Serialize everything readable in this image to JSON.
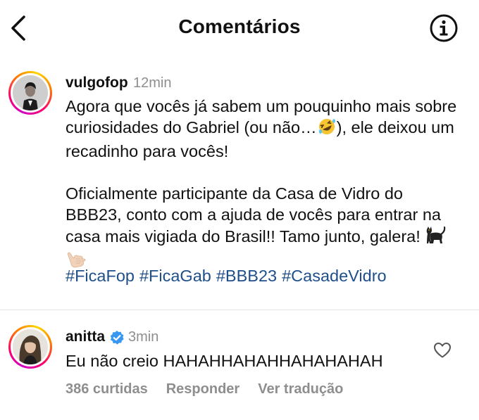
{
  "header": {
    "title": "Comentários",
    "back_icon": "chevron-left-icon",
    "info_icon": "info-circle-icon"
  },
  "post": {
    "username": "vulgofop",
    "time": "12min",
    "paragraphs": [
      "Agora que vocês já sabem um pouquinho mais sobre curiosidades do Gabriel (ou não…",
      "), ele deixou um recadinho para vocês!"
    ],
    "paragraph2": "Oficialmente participante da Casa de Vidro do BBB23, conto com a ajuda de vocês para entrar na casa mais vigiada do Brasil!! Tamo junto, galera!",
    "emojis": [
      "rofl-emoji",
      "black-cat-emoji",
      "call-me-hand-emoji"
    ],
    "hashtags": [
      "#FicaFop",
      "#FicaGab",
      "#BBB23",
      "#CasadeVidro"
    ]
  },
  "comment": {
    "username": "anitta",
    "verified": true,
    "time": "3min",
    "text": "Eu não creio HAHAHHAHAHHAHAHAHAH",
    "likes": "386 curtidas",
    "reply_label": "Responder",
    "translate_label": "Ver tradução"
  },
  "colors": {
    "link": "#1f4f8a",
    "secondary_text": "#8e8e8e",
    "verified_blue": "#3897f0",
    "divider": "#e3e3e3"
  }
}
